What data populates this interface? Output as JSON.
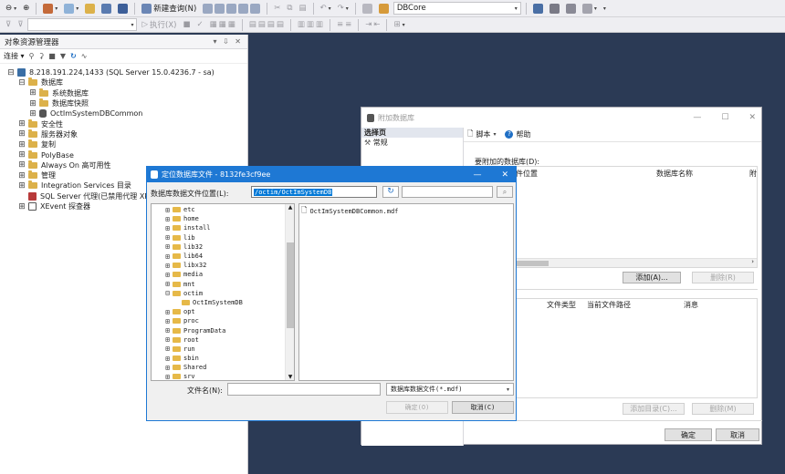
{
  "toolbar1": {
    "new_query_label": "新建查询(N)",
    "database_combo": "DBCore"
  },
  "toolbar2": {
    "execute_label": "执行(X)"
  },
  "object_explorer": {
    "title": "对象资源管理器",
    "title_controls": "▾ ⇩ ✕",
    "toolbar": {
      "connect_label": "连接 ▾"
    },
    "tree": [
      {
        "indent": 0,
        "toggle": "⊟",
        "icon": "server",
        "label": "8.218.191.224,1433 (SQL Server 15.0.4236.7 - sa)"
      },
      {
        "indent": 1,
        "toggle": "⊟",
        "icon": "folder",
        "label": "数据库"
      },
      {
        "indent": 2,
        "toggle": "⊞",
        "icon": "folder",
        "label": "系统数据库"
      },
      {
        "indent": 2,
        "toggle": "⊞",
        "icon": "folder",
        "label": "数据库快照"
      },
      {
        "indent": 2,
        "toggle": "⊞",
        "icon": "database",
        "label": "OctImSystemDBCommon"
      },
      {
        "indent": 1,
        "toggle": "⊞",
        "icon": "folder",
        "label": "安全性"
      },
      {
        "indent": 1,
        "toggle": "⊞",
        "icon": "folder",
        "label": "服务器对象"
      },
      {
        "indent": 1,
        "toggle": "⊞",
        "icon": "folder",
        "label": "复制"
      },
      {
        "indent": 1,
        "toggle": "⊞",
        "icon": "folder",
        "label": "PolyBase"
      },
      {
        "indent": 1,
        "toggle": "⊞",
        "icon": "folder",
        "label": "Always On 高可用性"
      },
      {
        "indent": 1,
        "toggle": "⊞",
        "icon": "folder",
        "label": "管理"
      },
      {
        "indent": 1,
        "toggle": "⊞",
        "icon": "folder",
        "label": "Integration Services 目录"
      },
      {
        "indent": 1,
        "toggle": "",
        "icon": "agent",
        "label": "SQL Server 代理(已禁用代理 XP)"
      },
      {
        "indent": 1,
        "toggle": "⊞",
        "icon": "xevent",
        "label": "XEvent 探查器"
      }
    ]
  },
  "attach_dialog": {
    "title": "附加数据库",
    "select_page_header": "选择页",
    "pages": [
      "常规"
    ],
    "script_label": "脚本",
    "help_label": "帮助",
    "databases_to_attach_label": "要附加的数据库(D):",
    "col_file_location": "件位置",
    "col_db_name": "数据库名称",
    "col_attach_as": "附",
    "add_button": "添加(A)...",
    "remove_button": "删除(R)",
    "details_col_file_type": "文件类型",
    "details_col_current_path": "当前文件路径",
    "details_col_message": "消息",
    "add_catalog_button": "添加目录(C)...",
    "remove_button2": "删除(M)",
    "ok_button": "确定",
    "cancel_button": "取消"
  },
  "locate_dialog": {
    "title": "定位数据库文件 - 8132fe3cf9ee",
    "path_label": "数据库数据文件位置(L):",
    "path_value": "/octim/OctImSystemDB",
    "directories": [
      {
        "indent": 1,
        "name": "etc",
        "toggle": "⊞"
      },
      {
        "indent": 1,
        "name": "home",
        "toggle": "⊞"
      },
      {
        "indent": 1,
        "name": "install",
        "toggle": "⊞"
      },
      {
        "indent": 1,
        "name": "lib",
        "toggle": "⊞"
      },
      {
        "indent": 1,
        "name": "lib32",
        "toggle": "⊞"
      },
      {
        "indent": 1,
        "name": "lib64",
        "toggle": "⊞"
      },
      {
        "indent": 1,
        "name": "libx32",
        "toggle": "⊞"
      },
      {
        "indent": 1,
        "name": "media",
        "toggle": "⊞"
      },
      {
        "indent": 1,
        "name": "mnt",
        "toggle": "⊞"
      },
      {
        "indent": 1,
        "name": "octim",
        "toggle": "⊟"
      },
      {
        "indent": 2,
        "name": "OctImSystemDB",
        "toggle": ""
      },
      {
        "indent": 1,
        "name": "opt",
        "toggle": "⊞"
      },
      {
        "indent": 1,
        "name": "proc",
        "toggle": "⊞"
      },
      {
        "indent": 1,
        "name": "ProgramData",
        "toggle": "⊞"
      },
      {
        "indent": 1,
        "name": "root",
        "toggle": "⊞"
      },
      {
        "indent": 1,
        "name": "run",
        "toggle": "⊞"
      },
      {
        "indent": 1,
        "name": "sbin",
        "toggle": "⊞"
      },
      {
        "indent": 1,
        "name": "Shared",
        "toggle": "⊞"
      },
      {
        "indent": 1,
        "name": "srv",
        "toggle": "⊞"
      }
    ],
    "files": [
      "OctImSystemDBCommon.mdf"
    ],
    "filename_label": "文件名(N):",
    "filename_value": "",
    "filter_value": "数据库数据文件(*.mdf)",
    "ok_button": "确定(O)",
    "cancel_button": "取消(C)"
  }
}
